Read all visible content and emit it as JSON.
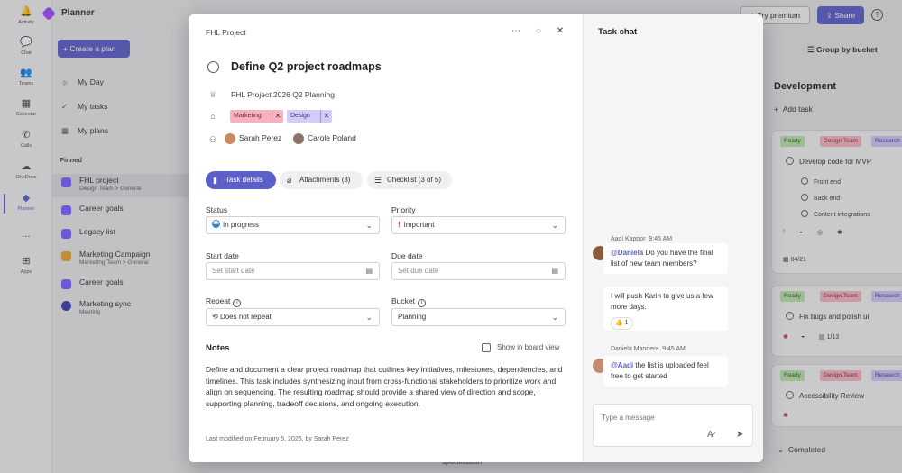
{
  "rail": [
    {
      "label": "Activity",
      "icon": "bell-icon"
    },
    {
      "label": "Chat",
      "icon": "chat-icon"
    },
    {
      "label": "Teams",
      "icon": "teams-icon"
    },
    {
      "label": "Calendar",
      "icon": "calendar-icon"
    },
    {
      "label": "Calls",
      "icon": "phone-icon"
    },
    {
      "label": "OneDrive",
      "icon": "cloud-icon"
    },
    {
      "label": "Planner",
      "icon": "planner-icon"
    },
    {
      "label": "...",
      "icon": "more-icon"
    },
    {
      "label": "Apps",
      "icon": "apps-icon"
    }
  ],
  "app": {
    "brand": "Planner",
    "create_plan": "Create a plan",
    "nav": [
      "My Day",
      "My tasks",
      "My plans"
    ],
    "pinned": "Pinned",
    "plans": [
      {
        "name": "FHL project",
        "sub": "Design Team > General"
      },
      {
        "name": "Career goals",
        "sub": ""
      },
      {
        "name": "Legacy list",
        "sub": ""
      },
      {
        "name": "Marketing Campaign",
        "sub": "Marketing Team > General"
      },
      {
        "name": "Career goals",
        "sub": ""
      },
      {
        "name": "Marketing sync",
        "sub": "Meeting"
      }
    ],
    "try_premium": "Try premium",
    "share": "Share",
    "group_by": "Group by bucket",
    "bucket": "Development",
    "add_task": "Add task",
    "card1": {
      "tags": [
        "Ready",
        "Design Team",
        "Research"
      ],
      "title": "Develop code for MVP",
      "checklist": [
        "Front end",
        "Back end",
        "Content integrations"
      ],
      "date": "04/21"
    },
    "card2": {
      "tags": [
        "Ready",
        "Design Team",
        "Research"
      ],
      "title": "Fix bugs and polish ui",
      "count": "1/13"
    },
    "card3": {
      "tags": [
        "Ready",
        "Design Team",
        "Research"
      ],
      "title": "Accessibility Review"
    },
    "completed": "Completed",
    "behind_text": "specification"
  },
  "modal": {
    "plan": "FHL Project",
    "title": "Define Q2 project roadmaps",
    "goal": "FHL Project 2026 Q2 Planning",
    "labels": [
      "Marketing",
      "Design"
    ],
    "assignees": [
      "Sarah Perez",
      "Carole Poland"
    ],
    "tabs": [
      "Task details",
      "Attachments (3)",
      "Checklist (3 of 5)"
    ],
    "status_label": "Status",
    "status_value": "In progress",
    "priority_label": "Priority",
    "priority_value": "Important",
    "start_label": "Start date",
    "start_placeholder": "Set start date",
    "due_label": "Due date",
    "due_placeholder": "Set due date",
    "repeat_label": "Repeat",
    "repeat_value": "Does not repeat",
    "bucket_label": "Bucket",
    "bucket_value": "Planning",
    "notes_label": "Notes",
    "show_board": "Show in board view",
    "notes": "Define and document a clear project roadmap that outlines key initiatives, milestones, dependencies, and timelines. This task includes synthesizing input from cross-functional stakeholders to prioritize work and align on sequencing. The resulting roadmap should provide a shared view of direction and scope, supporting planning, tradeoff decisions, and ongoing execution.",
    "modified": "Last modified on February 5, 2026, by Sarah Perez"
  },
  "chat": {
    "title": "Task chat",
    "msg1": {
      "author": "Aadi Kapoor",
      "time": "9:45 AM",
      "mention": "@Daniela",
      "text": " Do you have the final list of new team members?",
      "text2": "I will push Karin to give us a few more days.",
      "reaction": "1"
    },
    "msg2": {
      "author": "Daniela Mandera",
      "time": "9:45 AM",
      "mention": "@Aadi",
      "text": " the list is uploaded feel free to get started"
    },
    "input_placeholder": "Type a message"
  }
}
